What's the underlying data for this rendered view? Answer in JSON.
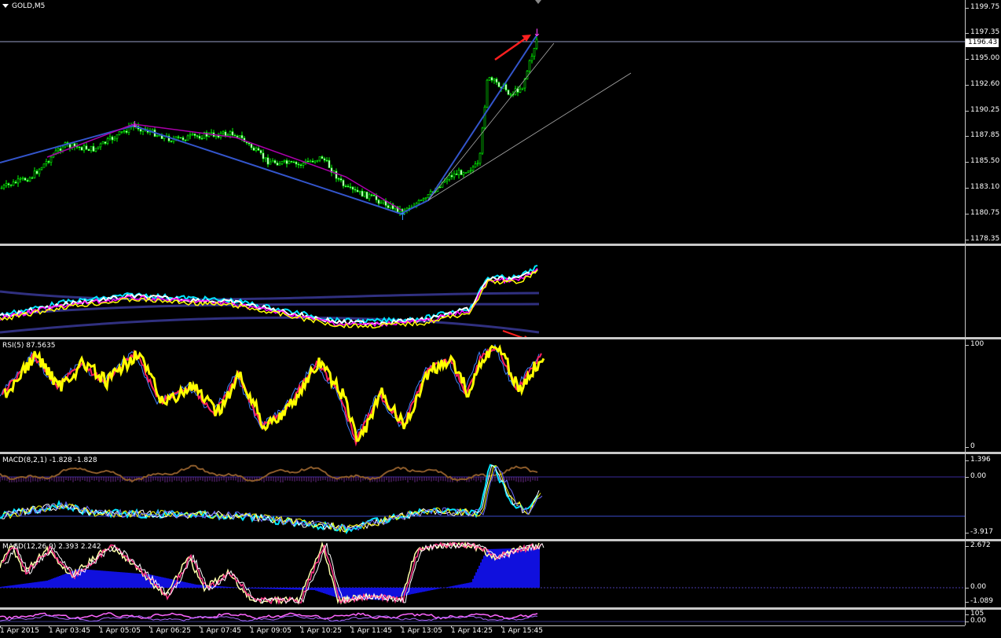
{
  "window": {
    "symbol_title": "GOLD,M5"
  },
  "main_chart": {
    "price_scale": [
      "1199.75",
      "1197.35",
      "1195.00",
      "1192.60",
      "1190.25",
      "1187.85",
      "1185.50",
      "1183.10",
      "1180.75",
      "1178.35"
    ],
    "current_price": "1196.43",
    "colors": {
      "bull": "#00ff00",
      "trend": "#3355cc",
      "zigzag": "#cc00cc"
    }
  },
  "oscillator_pane": {
    "label": ""
  },
  "rsi_pane": {
    "label": "RSI(5) 87.5635",
    "scale": [
      "100",
      "0"
    ]
  },
  "macd1_pane": {
    "label": "MACD(8,2,1) -1.828 -1.828",
    "scale": [
      "1.396",
      "0.00",
      "-3.917"
    ]
  },
  "macd2_pane": {
    "label": "MACD(12,26,9) 2.393 2.242",
    "scale": [
      "2.672",
      "0.00",
      "-1.089"
    ]
  },
  "bottom_pane": {
    "scale": [
      "105",
      "0.00"
    ]
  },
  "time_axis": [
    "1 Apr 2015",
    "1 Apr 03:45",
    "1 Apr 05:05",
    "1 Apr 06:25",
    "1 Apr 07:45",
    "1 Apr 09:05",
    "1 Apr 10:25",
    "1 Apr 11:45",
    "1 Apr 13:05",
    "1 Apr 14:25",
    "1 Apr 15:45"
  ]
}
